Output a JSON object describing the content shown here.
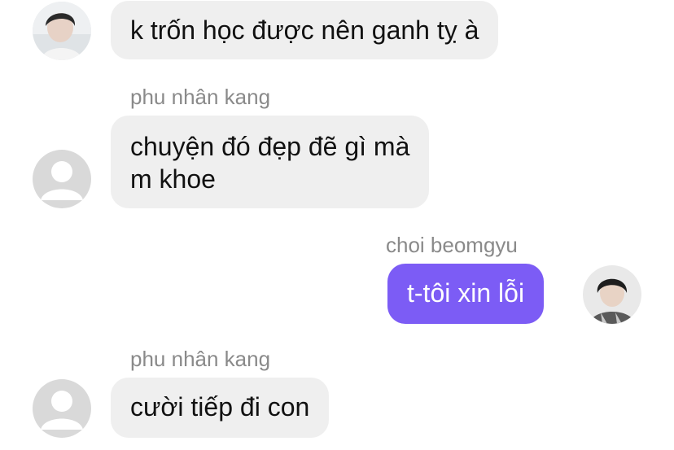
{
  "messages": [
    {
      "text": "k trốn học được nên ganh tỵ à"
    },
    {
      "sender": "phu nhân kang",
      "lines": [
        "chuyện đó đẹp đẽ gì mà",
        "m khoe"
      ]
    },
    {
      "sender": "choi beomgyu",
      "text": "t-tôi xin lỗi"
    },
    {
      "sender": "phu nhân kang",
      "text": "cười tiếp đi con"
    }
  ],
  "colors": {
    "outgoing_bubble": "#7c5cf5",
    "incoming_bubble": "#efefef",
    "sender_name": "#8a8a8a"
  },
  "icons": [
    "photo-avatar",
    "default-avatar-icon",
    "photo-avatar",
    "default-avatar-icon"
  ]
}
